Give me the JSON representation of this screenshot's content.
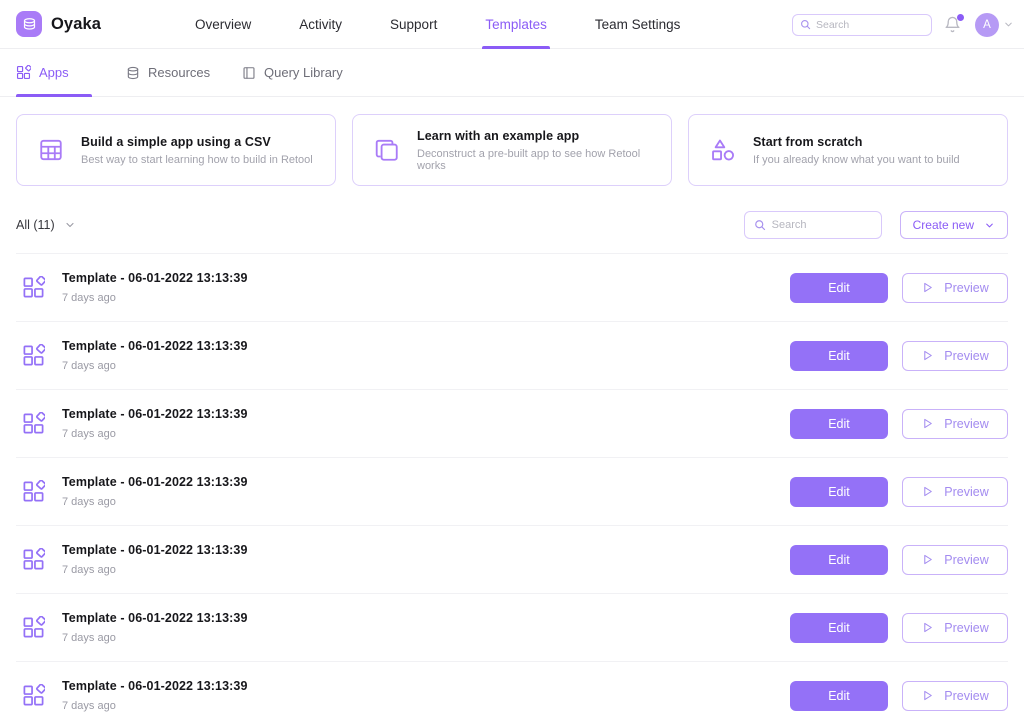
{
  "brand": {
    "name": "Oyaka",
    "logo_icon": "layers-icon",
    "color": "#a97bf7"
  },
  "topnav": {
    "links": [
      {
        "label": "Overview",
        "active": false
      },
      {
        "label": "Activity",
        "active": false
      },
      {
        "label": "Support",
        "active": false
      },
      {
        "label": "Templates",
        "active": true
      },
      {
        "label": "Team Settings",
        "active": false
      }
    ],
    "search": {
      "placeholder": "Search",
      "value": "",
      "icon": "search-icon"
    },
    "bell": {
      "icon": "bell-icon",
      "has_badge": true,
      "badge_color": "#8b5cf6"
    },
    "avatar": {
      "initial": "A",
      "icon": "chevron-down-icon"
    }
  },
  "subtabs": [
    {
      "label": "Apps",
      "icon": "apps-grid-icon",
      "active": true
    },
    {
      "label": "Resources",
      "icon": "database-icon",
      "active": false
    },
    {
      "label": "Query Library",
      "icon": "book-icon",
      "active": false
    }
  ],
  "cards": [
    {
      "title": "Build a simple app using a CSV",
      "subtitle": "Best way to start learning how to build in Retool",
      "icon": "table-icon"
    },
    {
      "title": "Learn with an example app",
      "subtitle": "Deconstruct a pre-built app to see how Retool works",
      "icon": "copy-squares-icon"
    },
    {
      "title": "Start from scratch",
      "subtitle": "If you already know what you want to build",
      "icon": "shapes-icon"
    }
  ],
  "filterbar": {
    "filter_label": "All (11)",
    "filter_icon": "chevron-down-icon",
    "search": {
      "placeholder": "Search",
      "value": "",
      "icon": "search-icon"
    },
    "create_label": "Create new",
    "create_icon": "chevron-down-icon"
  },
  "list": {
    "edit_label": "Edit",
    "preview_label": "Preview",
    "preview_icon": "play-icon",
    "row_icon": "app-grid-icon",
    "rows": [
      {
        "title": "Template - 06-01-2022 13:13:39",
        "time": "7 days ago"
      },
      {
        "title": "Template - 06-01-2022 13:13:39",
        "time": "7 days ago"
      },
      {
        "title": "Template - 06-01-2022 13:13:39",
        "time": "7 days ago"
      },
      {
        "title": "Template - 06-01-2022 13:13:39",
        "time": "7 days ago"
      },
      {
        "title": "Template - 06-01-2022 13:13:39",
        "time": "7 days ago"
      },
      {
        "title": "Template - 06-01-2022 13:13:39",
        "time": "7 days ago"
      },
      {
        "title": "Template - 06-01-2022 13:13:39",
        "time": "7 days ago"
      }
    ]
  },
  "colors": {
    "accent": "#8b5cf6",
    "accent_solid": "#9471f7",
    "accent_light": "#b69af5",
    "border": "#d9c9fb",
    "divider": "#f1f1f4"
  }
}
